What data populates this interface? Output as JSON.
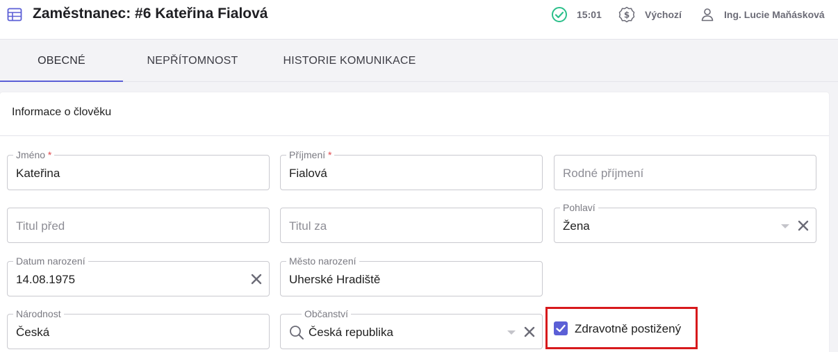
{
  "header": {
    "title": "Zaměstnanec: #6 Kateřina Fialová",
    "time": "15:01",
    "workspace": "Výchozí",
    "user": "Ing. Lucie Maňásková",
    "icons": {
      "title": "table-icon",
      "status": "check-circle-icon",
      "workspace": "money-icon",
      "user": "user-icon"
    },
    "colors": {
      "accent": "#5b5fd6",
      "status": "#2bbf8a"
    }
  },
  "tabs": [
    {
      "label": "OBECNÉ",
      "active": true
    },
    {
      "label": "NEPŘÍTOMNOST",
      "active": false
    },
    {
      "label": "HISTORIE KOMUNIKACE",
      "active": false
    }
  ],
  "section": {
    "title": "Informace o člověku"
  },
  "fields": {
    "first_name": {
      "label": "Jméno",
      "required": "*",
      "value": "Kateřina"
    },
    "last_name": {
      "label": "Příjmení",
      "required": "*",
      "value": "Fialová"
    },
    "birth_surname": {
      "placeholder": "Rodné příjmení"
    },
    "title_before": {
      "placeholder": "Titul před"
    },
    "title_after": {
      "placeholder": "Titul za"
    },
    "gender": {
      "label": "Pohlaví",
      "value": "Žena"
    },
    "birth_date": {
      "label": "Datum narození",
      "value": "14.08.1975"
    },
    "birth_city": {
      "label": "Město narození",
      "value": "Uherské Hradiště"
    },
    "nationality": {
      "label": "Národnost",
      "value": "Česká"
    },
    "citizenship": {
      "label": "Občanství",
      "value": "Česká republika"
    },
    "disabled": {
      "label": "Zdravotně postižený",
      "checked": true
    }
  }
}
